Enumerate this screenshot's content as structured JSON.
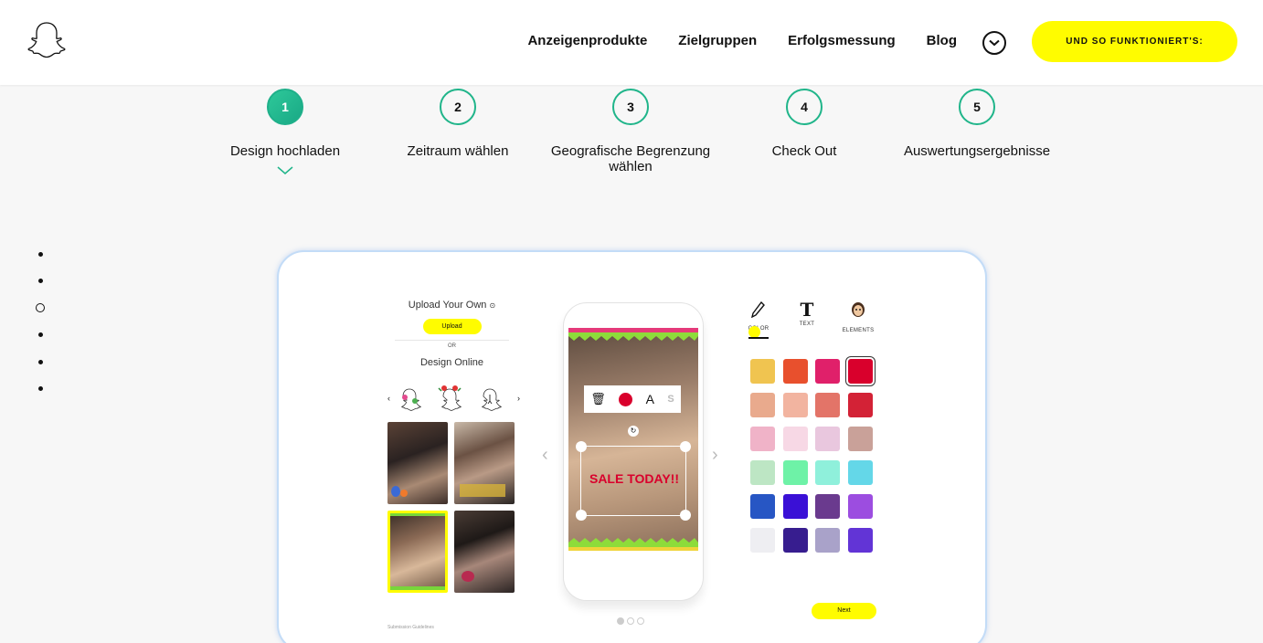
{
  "header": {
    "nav": [
      "Anzeigenprodukte",
      "Zielgruppen",
      "Erfolgsmessung",
      "Blog"
    ],
    "cta_label": "UND SO FUNKTIONIERT'S:"
  },
  "steps": [
    {
      "number": "1",
      "label": "Design hochladen",
      "active": true
    },
    {
      "number": "2",
      "label": "Zeitraum wählen"
    },
    {
      "number": "3",
      "label": "Geografische Begrenzung wählen"
    },
    {
      "number": "4",
      "label": "Check Out"
    },
    {
      "number": "5",
      "label": "Auswertungsergebnisse"
    }
  ],
  "editor": {
    "upload_title": "Upload Your Own",
    "upload_button": "Upload",
    "or_label": "OR",
    "design_online": "Design Online",
    "submission_guidelines": "Submission Guidelines",
    "sticker_text": "SALE TODAY!!",
    "text_tool_letter": "A",
    "tools": [
      {
        "label": "COLOR",
        "icon": "pencil-icon"
      },
      {
        "label": "TEXT",
        "icon": "text-t-icon"
      },
      {
        "label": "ELEMENTS",
        "icon": "bitmoji-icon"
      }
    ],
    "next_button": "Next"
  },
  "colors": {
    "accent_yellow": "#fffc00",
    "step_green": "#20b58a",
    "palette": [
      [
        "#f0c450",
        "#e8502d",
        "#e0206a",
        "#d9002c"
      ],
      [
        "#e9aa8d",
        "#f2b4a0",
        "#e37468",
        "#d32236"
      ],
      [
        "#f0b3c8",
        "#f7d8e5",
        "#e9c7de",
        "#c9a199"
      ],
      [
        "#bde6c4",
        "#6ef2a7",
        "#8ff0db",
        "#64d7e8"
      ],
      [
        "#2756c4",
        "#3a10d6",
        "#6a3a8e",
        "#9c4de0"
      ],
      [
        "#eeeef2",
        "#371d8f",
        "#a9a2c9",
        "#6234d6"
      ]
    ]
  }
}
